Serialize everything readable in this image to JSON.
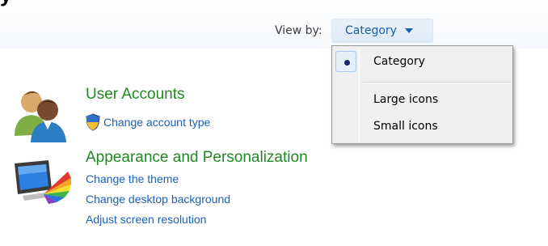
{
  "header": {
    "heading_fragment": "y"
  },
  "view_by": {
    "label": "View by:",
    "selected": "Category"
  },
  "menu": {
    "items": [
      {
        "label": "Category",
        "selected": true
      },
      {
        "label": "Large icons",
        "selected": false
      },
      {
        "label": "Small icons",
        "selected": false
      }
    ]
  },
  "sections": [
    {
      "title": "User Accounts",
      "icon": "users-icon",
      "links": [
        {
          "label": "Change account type",
          "icon": "shield-icon"
        }
      ]
    },
    {
      "title": "Appearance and Personalization",
      "icon": "monitor-paint-icon",
      "links": [
        {
          "label": "Change the theme"
        },
        {
          "label": "Change desktop background"
        },
        {
          "label": "Adjust screen resolution"
        }
      ]
    }
  ],
  "colors": {
    "section_title": "#1e8a21",
    "link": "#1a61b8",
    "viewby_text": "#1c5da8"
  }
}
